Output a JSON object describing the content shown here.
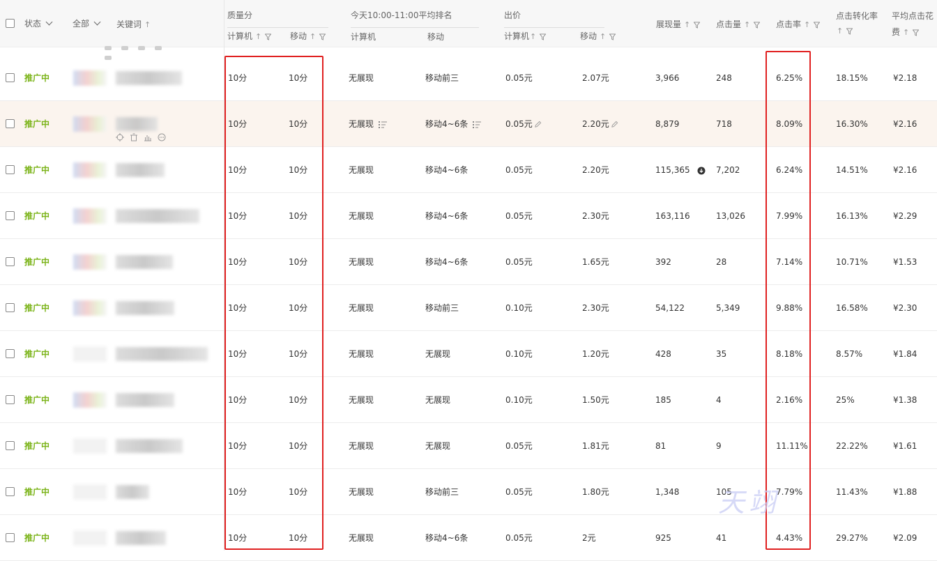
{
  "header": {
    "status_label": "状态",
    "all_label": "全部",
    "keyword_label": "关键词",
    "quality_group": "质量分",
    "quality_pc": "计算机",
    "quality_mobile": "移动",
    "rank_group": "今天10:00-11:00平均排名",
    "rank_pc": "计算机",
    "rank_mobile": "移动",
    "bid_group": "出价",
    "bid_pc": "计算机",
    "bid_mobile": "移动",
    "impressions": "展现量",
    "clicks": "点击量",
    "ctr": "点击率",
    "conversion_l1": "点击转化率",
    "avg_cost_l1": "平均点击花",
    "avg_cost_l2": "费"
  },
  "watermark": "天翊",
  "colors": {
    "status_green": "#7ab317",
    "highlight_box": "#e02020",
    "row_highlight": "#fbf4ee"
  },
  "rows": [
    {
      "status": "推广中",
      "q_pc": "10分",
      "q_mobile": "10分",
      "rank_pc": "无展现",
      "rank_mobile": "移动前三",
      "bid_pc": "0.05元",
      "bid_mobile": "2.07元",
      "impressions": "3,966",
      "clicks": "248",
      "ctr": "6.25%",
      "conversion": "18.15%",
      "avg_cost": "¥2.18"
    },
    {
      "status": "推广中",
      "q_pc": "10分",
      "q_mobile": "10分",
      "rank_pc": "无展现",
      "rank_mobile": "移动4~6条",
      "bid_pc": "0.05元",
      "bid_mobile": "2.20元",
      "impressions": "8,879",
      "clicks": "718",
      "ctr": "8.09%",
      "conversion": "16.30%",
      "avg_cost": "¥2.16"
    },
    {
      "status": "推广中",
      "q_pc": "10分",
      "q_mobile": "10分",
      "rank_pc": "无展现",
      "rank_mobile": "移动4~6条",
      "bid_pc": "0.05元",
      "bid_mobile": "2.20元",
      "impressions": "115,365",
      "clicks": "7,202",
      "ctr": "6.24%",
      "conversion": "14.51%",
      "avg_cost": "¥2.16"
    },
    {
      "status": "推广中",
      "q_pc": "10分",
      "q_mobile": "10分",
      "rank_pc": "无展现",
      "rank_mobile": "移动4~6条",
      "bid_pc": "0.05元",
      "bid_mobile": "2.30元",
      "impressions": "163,116",
      "clicks": "13,026",
      "ctr": "7.99%",
      "conversion": "16.13%",
      "avg_cost": "¥2.29"
    },
    {
      "status": "推广中",
      "q_pc": "10分",
      "q_mobile": "10分",
      "rank_pc": "无展现",
      "rank_mobile": "移动4~6条",
      "bid_pc": "0.05元",
      "bid_mobile": "1.65元",
      "impressions": "392",
      "clicks": "28",
      "ctr": "7.14%",
      "conversion": "10.71%",
      "avg_cost": "¥1.53"
    },
    {
      "status": "推广中",
      "q_pc": "10分",
      "q_mobile": "10分",
      "rank_pc": "无展现",
      "rank_mobile": "移动前三",
      "bid_pc": "0.10元",
      "bid_mobile": "2.30元",
      "impressions": "54,122",
      "clicks": "5,349",
      "ctr": "9.88%",
      "conversion": "16.58%",
      "avg_cost": "¥2.30"
    },
    {
      "status": "推广中",
      "q_pc": "10分",
      "q_mobile": "10分",
      "rank_pc": "无展现",
      "rank_mobile": "无展现",
      "bid_pc": "0.10元",
      "bid_mobile": "1.20元",
      "impressions": "428",
      "clicks": "35",
      "ctr": "8.18%",
      "conversion": "8.57%",
      "avg_cost": "¥1.84"
    },
    {
      "status": "推广中",
      "q_pc": "10分",
      "q_mobile": "10分",
      "rank_pc": "无展现",
      "rank_mobile": "无展现",
      "bid_pc": "0.10元",
      "bid_mobile": "1.50元",
      "impressions": "185",
      "clicks": "4",
      "ctr": "2.16%",
      "conversion": "25%",
      "avg_cost": "¥1.38"
    },
    {
      "status": "推广中",
      "q_pc": "10分",
      "q_mobile": "10分",
      "rank_pc": "无展现",
      "rank_mobile": "无展现",
      "bid_pc": "0.05元",
      "bid_mobile": "1.81元",
      "impressions": "81",
      "clicks": "9",
      "ctr": "11.11%",
      "conversion": "22.22%",
      "avg_cost": "¥1.61"
    },
    {
      "status": "推广中",
      "q_pc": "10分",
      "q_mobile": "10分",
      "rank_pc": "无展现",
      "rank_mobile": "移动前三",
      "bid_pc": "0.05元",
      "bid_mobile": "1.80元",
      "impressions": "1,348",
      "clicks": "105",
      "ctr": "7.79%",
      "conversion": "11.43%",
      "avg_cost": "¥1.88"
    },
    {
      "status": "推广中",
      "q_pc": "10分",
      "q_mobile": "10分",
      "rank_pc": "无展现",
      "rank_mobile": "移动4~6条",
      "bid_pc": "0.05元",
      "bid_mobile": "2元",
      "impressions": "925",
      "clicks": "41",
      "ctr": "4.43%",
      "conversion": "29.27%",
      "avg_cost": "¥2.09"
    }
  ]
}
